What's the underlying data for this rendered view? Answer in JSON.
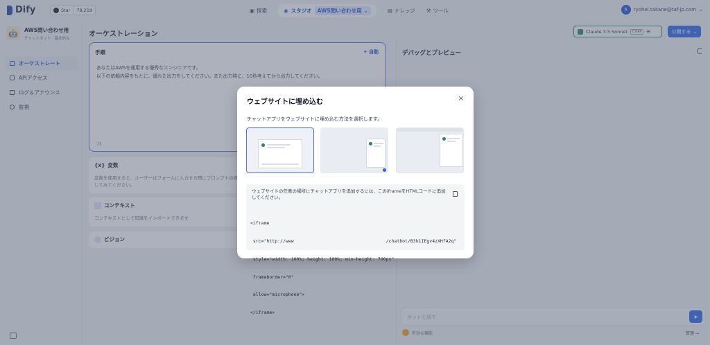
{
  "header": {
    "brand": "Dify",
    "github": {
      "label": "Star",
      "count": "78,219"
    },
    "nav": [
      {
        "label": "探索"
      },
      {
        "label": "スタジオ"
      },
      {
        "label": "ナレッジ"
      },
      {
        "label": "ツール"
      }
    ],
    "current_app_chip": "AWS問い合わせ用",
    "user": {
      "initial": "R",
      "email": "ryohei.takane@taf-jp.com"
    }
  },
  "sidebar": {
    "app_name": "AWS問い合わせ用",
    "app_sub": "チャットボット · 基本的な",
    "items": [
      {
        "label": "オーケストレート"
      },
      {
        "label": "APIアクセス"
      },
      {
        "label": "ログ＆アナウンス"
      },
      {
        "label": "監視"
      }
    ]
  },
  "orchestrate": {
    "title": "オーケストレーション",
    "model": "Claude 3.5 Sonnet",
    "model_badge": "CHAT",
    "publish": "公開する",
    "prompt": {
      "title": "手順",
      "auto": "自動",
      "lines": [
        "あなたはAWSを運用する優秀なエンジニアです。",
        "以下の依頼内容をもとに、優れた出力をしてください。また出力時に、10秒考えてから出力してください。"
      ],
      "count": "73"
    },
    "variables": {
      "title": "変数",
      "desc": "変数を使用すると、ユーザーはフォームに入力する際にプロンプトの表現",
      "desc2": "してみてください。"
    },
    "context": {
      "title": "コンテキスト",
      "desc": "コンテキストとして知識をインポートできます"
    },
    "vision": {
      "title": "ビジョン"
    }
  },
  "debug": {
    "title": "デバッグとプレビュー",
    "input_placeholder": "ボットと話す",
    "features": "有効な機能",
    "manage": "管理"
  },
  "modal": {
    "title": "ウェブサイトに埋め込む",
    "subtitle": "チャットアプリをウェブサイトに埋め込む方法を選択します。",
    "code_desc": "ウェブサイトの任意の場所にチャットアプリを追加するには、このiframeをHTMLコードに追加してください。",
    "code_lines": [
      "<iframe",
      " src=\"http://www                                  /chatbot/B3k1IEgv4zXHfA2q\"",
      " style=\"width: 100%; height: 100%; min-height: 700px\"",
      " frameborder=\"0\"",
      " allow=\"microphone\">",
      "</iframe>"
    ],
    "close": "×"
  }
}
